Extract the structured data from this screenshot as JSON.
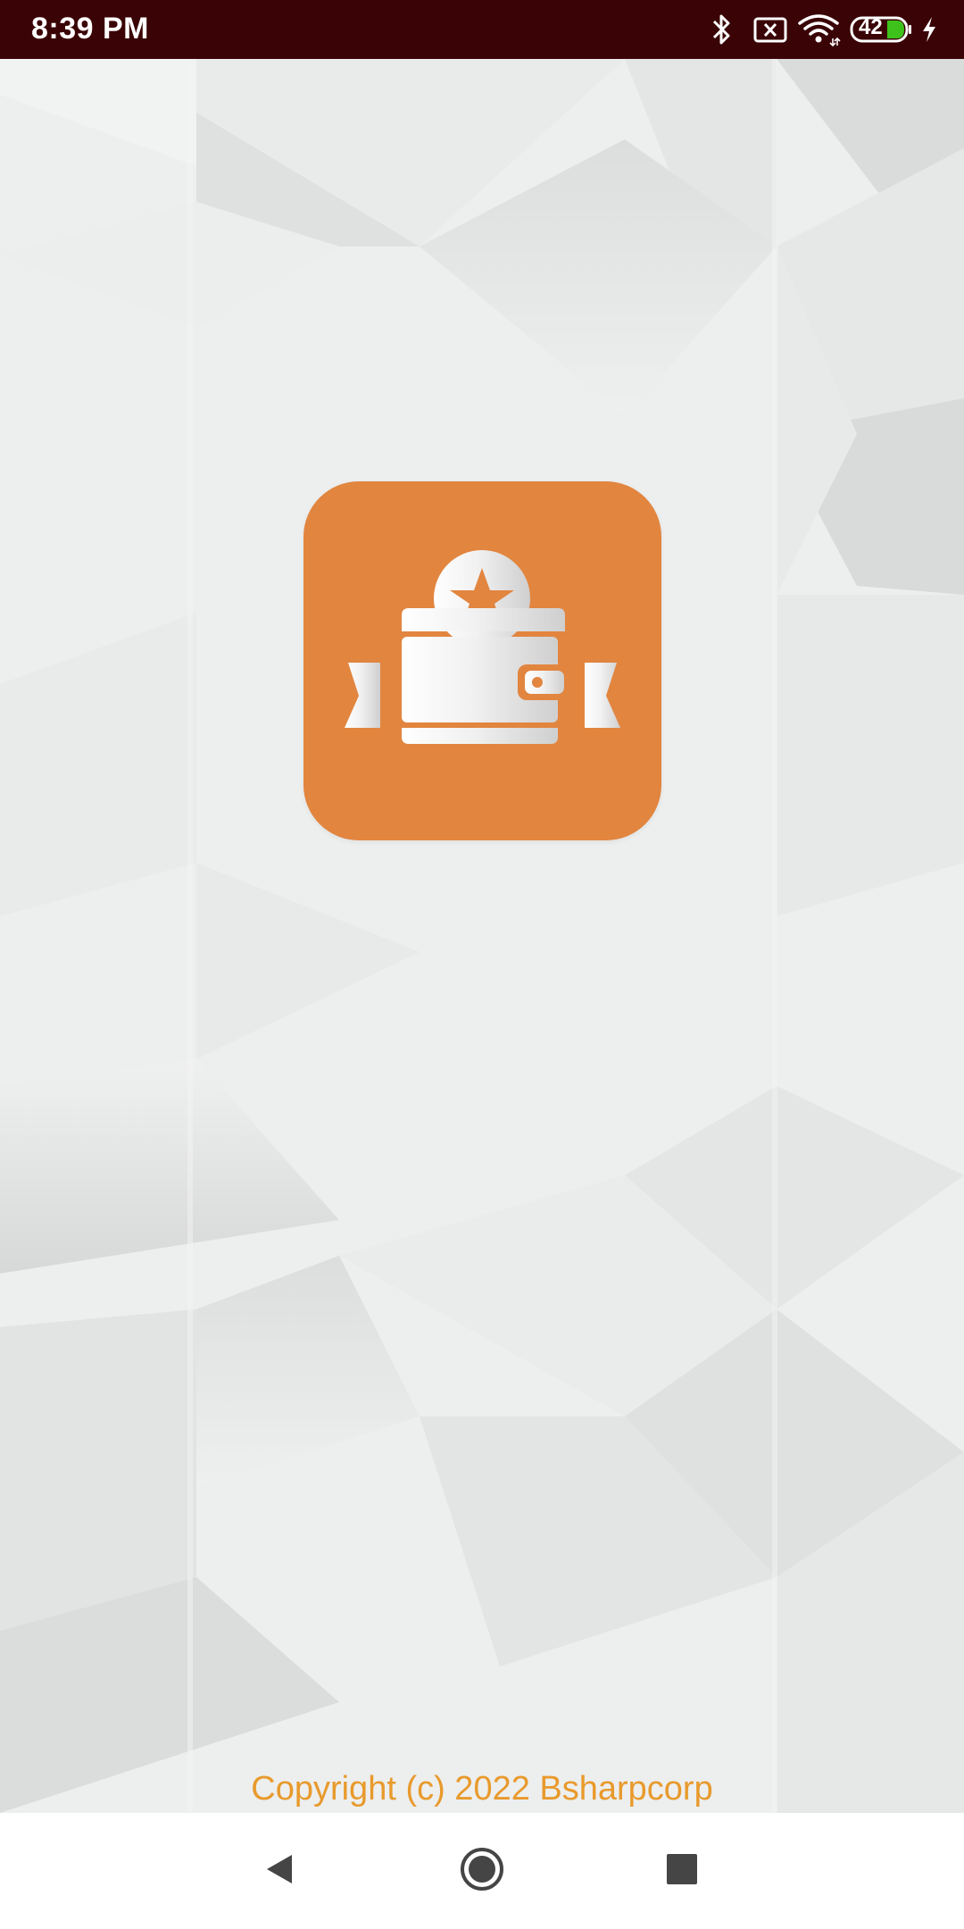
{
  "status_bar": {
    "time": "8:39 PM",
    "battery_level": "42",
    "icons": [
      "bluetooth-icon",
      "sim-no-signal-icon",
      "wifi-icon",
      "battery-icon",
      "charging-icon"
    ]
  },
  "splash": {
    "logo_icon": "wallet-star-ribbon-icon",
    "copyright": "Copyright (c) 2022 Bsharpcorp"
  },
  "navigation": {
    "buttons": [
      "back-button",
      "home-button",
      "recents-button"
    ]
  },
  "colors": {
    "status_bar_bg": "#3a0306",
    "logo_bg": "#e2853f",
    "copyright_text": "#e89a2c",
    "background": "#edeeee"
  }
}
